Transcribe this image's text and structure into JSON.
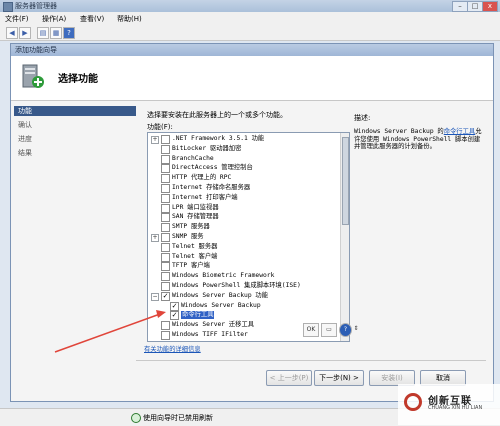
{
  "outer": {
    "title": "服务器管理器",
    "menus": [
      "文件(F)",
      "操作(A)",
      "查看(V)",
      "帮助(H)"
    ]
  },
  "wizard": {
    "title": "添加功能向导",
    "header_title": "选择功能",
    "nav": [
      "功能",
      "确认",
      "进度",
      "结果"
    ],
    "instruction": "选择要安装在此服务器上的一个或多个功能。",
    "features_label": "功能(F):",
    "features": [
      {
        "label": ".NET Framework 3.5.1 功能",
        "expander": "+",
        "checked": false
      },
      {
        "label": "BitLocker 驱动器加密",
        "expander": "",
        "checked": false
      },
      {
        "label": "BranchCache",
        "expander": "",
        "checked": false
      },
      {
        "label": "DirectAccess 管理控制台",
        "expander": "",
        "checked": false
      },
      {
        "label": "HTTP 代理上的 RPC",
        "expander": "",
        "checked": false
      },
      {
        "label": "Internet 存储命名服务器",
        "expander": "",
        "checked": false
      },
      {
        "label": "Internet 打印客户端",
        "expander": "",
        "checked": false
      },
      {
        "label": "LPR 端口监视器",
        "expander": "",
        "checked": false
      },
      {
        "label": "SAN 存储管理器",
        "expander": "",
        "checked": false
      },
      {
        "label": "SMTP 服务器",
        "expander": "",
        "checked": false
      },
      {
        "label": "SNMP 服务",
        "expander": "+",
        "checked": false
      },
      {
        "label": "Telnet 服务器",
        "expander": "",
        "checked": false
      },
      {
        "label": "Telnet 客户端",
        "expander": "",
        "checked": false
      },
      {
        "label": "TFTP 客户端",
        "expander": "",
        "checked": false
      },
      {
        "label": "Windows Biometric Framework",
        "expander": "",
        "checked": false
      },
      {
        "label": "Windows PowerShell 集成脚本环境(ISE)",
        "expander": "",
        "checked": false
      },
      {
        "label": "Windows Server Backup 功能",
        "expander": "−",
        "checked": true
      },
      {
        "label": "Windows Server Backup",
        "expander": "",
        "checked": true,
        "indent": 1
      },
      {
        "label": "命令行工具",
        "expander": "",
        "checked": true,
        "indent": 1,
        "selected": true
      },
      {
        "label": "Windows Server 迁移工具",
        "expander": "",
        "checked": false
      },
      {
        "label": "Windows TIFF IFilter",
        "expander": "",
        "checked": false
      }
    ],
    "link_text": "有关功能的详细信息",
    "desc_label": "描述:",
    "desc_pre": "Windows Server Backup 的",
    "desc_link": "命令行工具",
    "desc_post": "允许您使用 Windows PowerShell 脚本创建并管理此服务器的计划备份。",
    "buttons": {
      "prev": "< 上一步(P)",
      "next": "下一步(N) >",
      "install": "安装(I)",
      "cancel": "取消"
    }
  },
  "status": {
    "text": "使用向导时已禁用刷新"
  },
  "watermark": {
    "brand": "创新互联",
    "sub": "CHUANG XIN HU LIAN"
  }
}
